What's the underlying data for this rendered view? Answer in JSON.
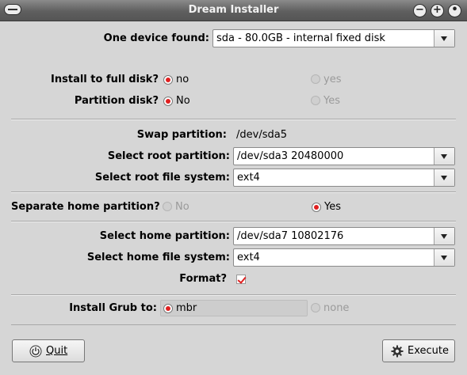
{
  "window": {
    "title": "Dream Installer"
  },
  "device": {
    "label": "One device found:",
    "selected": "sda - 80.0GB - internal fixed disk"
  },
  "full_disk": {
    "label": "Install to full disk?",
    "option_no": "no",
    "option_yes": "yes",
    "selected": "no"
  },
  "partition_disk": {
    "label": "Partition disk?",
    "option_no": "No",
    "option_yes": "Yes",
    "selected": "No"
  },
  "swap": {
    "label": "Swap partition:",
    "value": "/dev/sda5"
  },
  "root_partition": {
    "label": "Select root partition:",
    "selected": "/dev/sda3  20480000"
  },
  "root_fs": {
    "label": "Select root file system:",
    "selected": "ext4"
  },
  "separate_home": {
    "label": "Separate home partition?",
    "option_no": "No",
    "option_yes": "Yes",
    "selected": "Yes"
  },
  "home_partition": {
    "label": "Select home partition:",
    "selected": "/dev/sda7  10802176"
  },
  "home_fs": {
    "label": "Select home file system:",
    "selected": "ext4"
  },
  "format": {
    "label": "Format?",
    "checked": true
  },
  "grub": {
    "label": "Install Grub to:",
    "option_mbr": "mbr",
    "option_none": "none",
    "selected": "mbr"
  },
  "buttons": {
    "quit": "Quit",
    "execute": "Execute"
  },
  "icons": {
    "menu": "window-menu-icon",
    "minimize": "minimize-icon",
    "maximize": "maximize-icon",
    "close": "close-icon",
    "quit": "power-icon",
    "execute": "gear-icon"
  },
  "colors": {
    "radio_selected": "#e02020",
    "titlebar": "#5f5f5f"
  }
}
